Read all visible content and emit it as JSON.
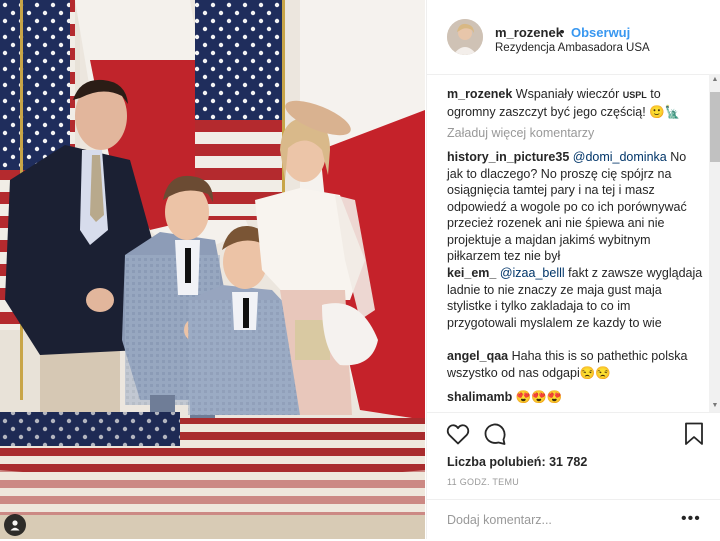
{
  "post": {
    "username": "m_rozenek",
    "follow_label": "Obserwuj",
    "location": "Rezydencja Ambasadora USA"
  },
  "caption": {
    "username": "m_rozenek",
    "text_part1": "Wspaniały wieczór",
    "text_flag": "USPL",
    "text_part2": "to ogromny zaszczyt być jego częścią! 🙂🗽"
  },
  "load_more_label": "Załaduj więcej komentarzy",
  "comments": [
    {
      "username": "history_in_picture35",
      "mention": "@domi_dominka",
      "text": "No jak to dlaczego? No proszę cię spójrz na osiągnięcia tamtej pary i na tej i masz odpowiedź a wogole po co ich porównywać przecież rozenek ani nie śpiewa ani nie projektuje a majdan jakimś wybitnym piłkarzem tez nie był"
    },
    {
      "username": "kei_em_",
      "mention": "@izaa_belll",
      "text": "fakt z zawsze wyglądaja ladnie to nie znaczy ze maja gust maja stylistke i tylko zakladaja to co im przygotowali myslalem ze kazdy to wie"
    },
    {
      "username": "angel_qaa",
      "mention": "",
      "text": "Haha this is so pathethic polska wszystko od nas odgapi😒😒"
    },
    {
      "username": "shalimamb",
      "mention": "",
      "text": "😍😍😍"
    }
  ],
  "likes_label": "Liczba polubień: 31 782",
  "time_label": "11 GODZ. TEMU",
  "add_comment_placeholder": "Dodaj komentarz...",
  "more_label": "•••",
  "icons": {
    "like": "heart-icon",
    "comment": "comment-icon",
    "save": "bookmark-icon",
    "tag": "user-tag-icon",
    "more": "more-options-icon"
  },
  "colors": {
    "link_blue": "#3897f0",
    "mention_blue": "#003569",
    "muted_gray": "#999999",
    "border": "#efefef"
  }
}
